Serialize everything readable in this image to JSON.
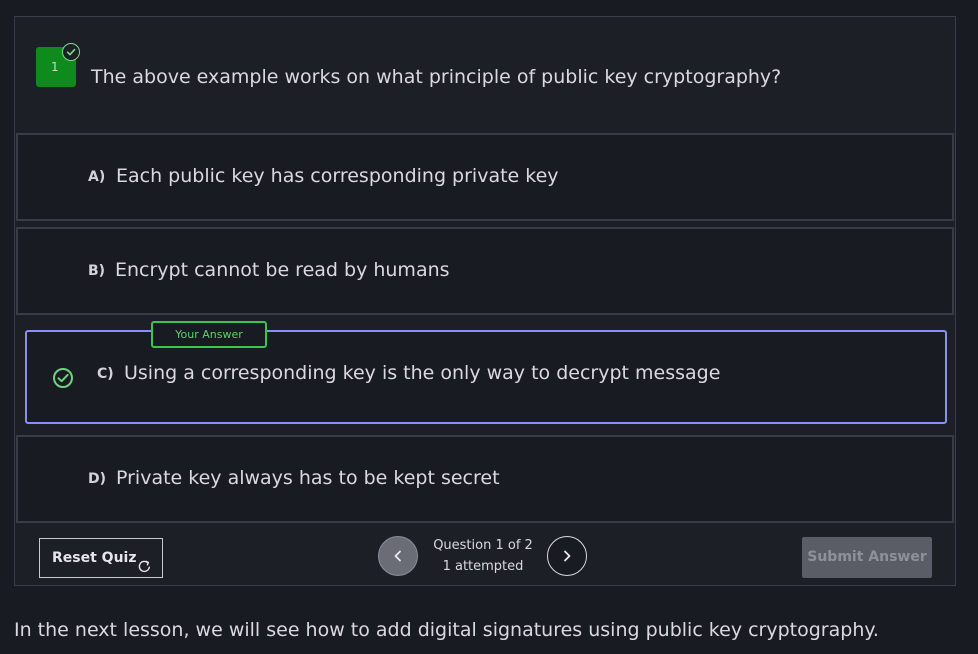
{
  "question": {
    "number": "1",
    "text": "The above example works on what principle of public key cryptography?"
  },
  "options": [
    {
      "letter": "A)",
      "text": "Each public key has corresponding private key"
    },
    {
      "letter": "B)",
      "text": "Encrypt cannot be read by humans"
    },
    {
      "letter": "C)",
      "text": "Using a corresponding key is the only way to decrypt message"
    },
    {
      "letter": "D)",
      "text": "Private key always has to be kept secret"
    }
  ],
  "your_answer_label": "Your Answer",
  "footer": {
    "reset_label": "Reset Quiz",
    "question_count": "Question 1 of 2",
    "attempted": "1 attempted",
    "submit_label": "Submit Answer"
  },
  "next_lesson_text": "In the next lesson, we will see how to add digital signatures using public key cryptography.",
  "colors": {
    "background": "#191b22",
    "correct_green": "#0f8a1c",
    "selected_border": "#8a8ff5",
    "your_answer_green": "#3fc24e"
  }
}
